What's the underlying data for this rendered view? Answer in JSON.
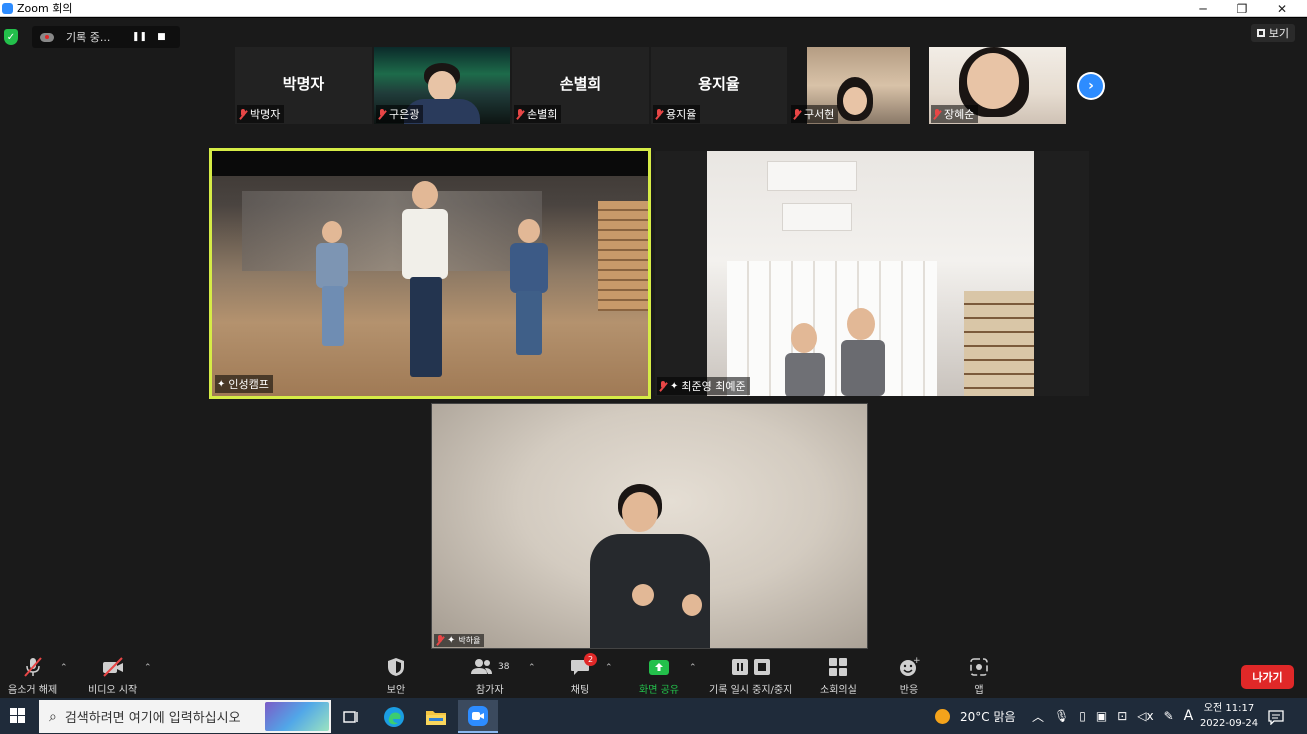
{
  "window": {
    "title": "Zoom 회의",
    "controls": [
      "─",
      "❐",
      "✕"
    ]
  },
  "meeting_bar": {
    "recording_label": "기록 중...",
    "view_label": "보기"
  },
  "thumbnails": [
    {
      "name": "박명자",
      "show_big_name": true
    },
    {
      "name": "구은광",
      "show_big_name": false
    },
    {
      "name": "손별희",
      "show_big_name": true
    },
    {
      "name": "용지율",
      "show_big_name": true
    },
    {
      "name": "구서현",
      "show_big_name": false
    },
    {
      "name": "장혜순",
      "show_big_name": false
    }
  ],
  "tiles": {
    "main": {
      "name": "인성캠프"
    },
    "right": {
      "name": "최준영 최예준"
    },
    "bottom": {
      "name": "박하율"
    }
  },
  "toolbar": {
    "unmute": "음소거 해제",
    "start_video": "비디오 시작",
    "security": "보안",
    "participants": "참가자",
    "participant_count": "38",
    "chat": "채팅",
    "chat_badge": "2",
    "share_screen": "화면 공유",
    "recording_control": "기록 일시 중지/중지",
    "breakout": "소회의실",
    "reactions": "반응",
    "apps": "앱",
    "leave": "나가기"
  },
  "taskbar": {
    "search_placeholder": "검색하려면 여기에 입력하십시오",
    "weather": "20°C  맑음",
    "time": "오전 11:17",
    "date": "2022-09-24",
    "ime": "A"
  },
  "colors": {
    "accent_blue": "#2d8cff",
    "active_speaker": "#d6ec46",
    "leave_red": "#e02828",
    "share_green": "#23c04b"
  }
}
